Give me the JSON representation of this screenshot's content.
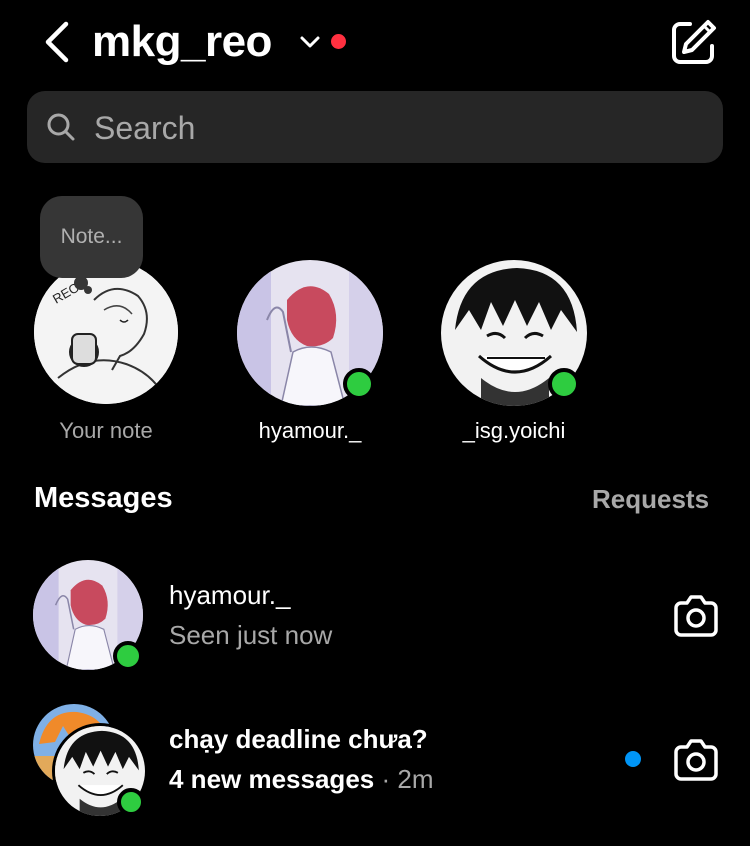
{
  "header": {
    "username": "mkg_reo",
    "colors": {
      "notification_dot": "#ff3040"
    }
  },
  "search": {
    "placeholder": "Search"
  },
  "notes": {
    "own": {
      "bubble_text": "Note...",
      "label": "Your note"
    },
    "stories": [
      {
        "label": "hyamour._",
        "online": true
      },
      {
        "label": "_isg.yoichi",
        "online": true
      }
    ]
  },
  "messages": {
    "title": "Messages",
    "requests_label": "Requests",
    "threads": [
      {
        "name": "hyamour._",
        "subtitle": "Seen just now",
        "online": true,
        "action_icon": "camera-icon"
      },
      {
        "name": "chạy deadline chưa?",
        "new_messages": "4 new messages",
        "separator": "·",
        "time": "2m",
        "unread": true,
        "online": true,
        "action_icon": "camera-icon"
      }
    ]
  },
  "colors": {
    "online": "#2ecc40",
    "unread": "#0095f6",
    "muted_text": "#a8a8a8"
  }
}
